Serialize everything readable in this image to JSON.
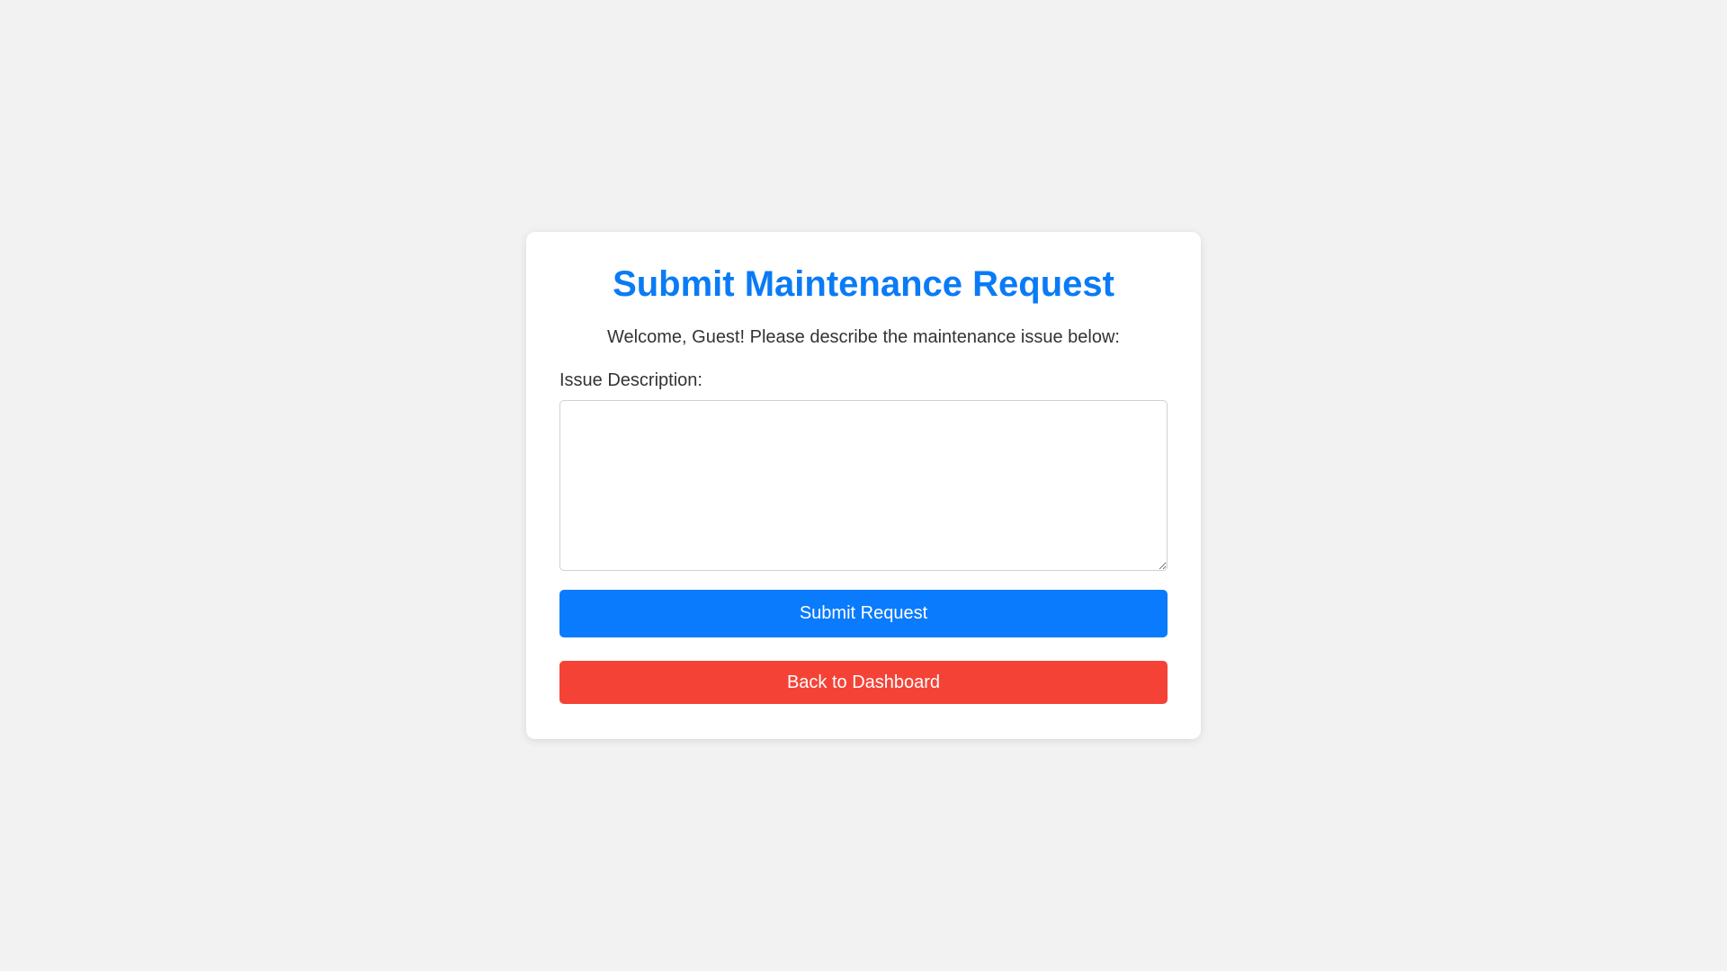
{
  "form": {
    "title": "Submit Maintenance Request",
    "welcome_text": "Welcome, Guest! Please describe the maintenance issue below:",
    "issue_label": "Issue Description:",
    "issue_value": "",
    "submit_label": "Submit Request",
    "back_label": "Back to Dashboard"
  },
  "colors": {
    "background": "#f2f2f2",
    "card": "#ffffff",
    "title": "#0a7bf5",
    "submit_button": "#0a7bfc",
    "back_button": "#f44336"
  }
}
